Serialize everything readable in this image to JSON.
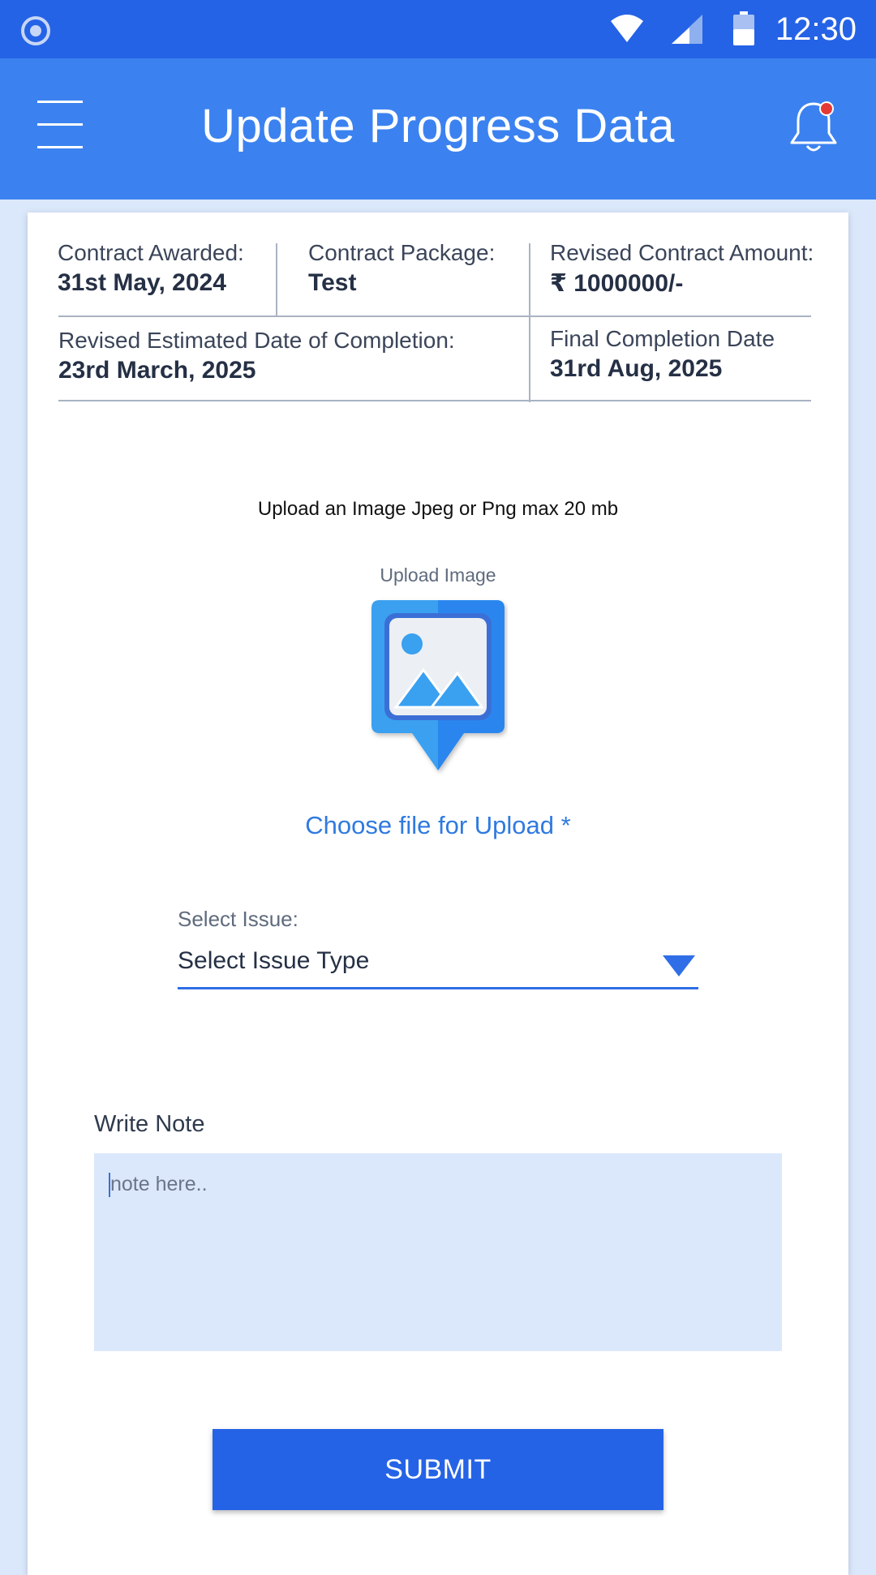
{
  "status_bar": {
    "time": "12:30",
    "icons": [
      "record-icon",
      "wifi-icon",
      "signal-icon",
      "battery-icon"
    ]
  },
  "app_bar": {
    "title": "Update Progress Data",
    "menu_icon": "hamburger-menu-icon",
    "notification_icon": "bell-icon",
    "notification_dot_color": "#e53935"
  },
  "contract_info": {
    "contract_awarded": {
      "label": "Contract Awarded:",
      "value": "31st May, 2024"
    },
    "contract_package": {
      "label": "Contract Package:",
      "value": "Test"
    },
    "revised_amount": {
      "label": "Revised Contract Amount:",
      "value": "₹ 1000000/-"
    },
    "revised_completion": {
      "label": "Revised Estimated Date of Completion:",
      "value": "23rd March, 2025"
    },
    "final_completion": {
      "label": "Final Completion Date",
      "value": "31rd Aug, 2025"
    }
  },
  "upload": {
    "hint": "Upload an Image Jpeg or Png max 20 mb",
    "caption": "Upload Image",
    "icon": "image-pin-icon",
    "choose_label": "Choose file for Upload *"
  },
  "issue": {
    "label": "Select Issue:",
    "selected": "Select Issue Type",
    "arrow_icon": "dropdown-arrow-icon"
  },
  "note": {
    "label": "Write Note",
    "placeholder": "note here..",
    "value": ""
  },
  "submit_label": "SUBMIT",
  "colors": {
    "primary": "#2563e6",
    "app_bar": "#3b82f0",
    "background": "#dbe8fc",
    "link": "#2f7ae0"
  }
}
